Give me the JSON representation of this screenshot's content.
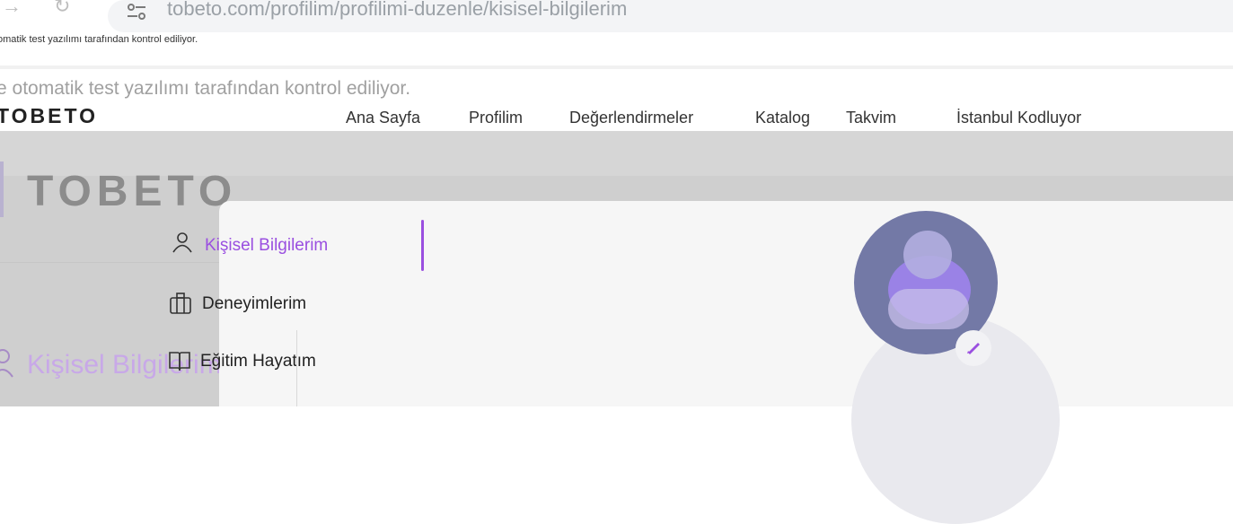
{
  "browser": {
    "url": "tobeto.com/profilim/profilimi-duzenle/kisisel-bilgilerim",
    "automation_notice": "omatik test yazılımı tarafından kontrol ediliyor."
  },
  "page": {
    "automation_notice": "e otomatik test yazılımı tarafından kontrol ediliyor.",
    "brand_small": "TOBETO",
    "brand_big": "TOBETO",
    "nav": [
      "Ana Sayfa",
      "Profilim",
      "Değerlendirmeler",
      "Katalog",
      "Takvim",
      "İstanbul Kodluyor"
    ],
    "ghost_heading": "Kişisel Bilgilerim"
  },
  "sidebar": {
    "items": [
      {
        "label": "Kişisel Bilgilerim",
        "icon": "user-icon",
        "active": true
      },
      {
        "label": "Deneyimlerim",
        "icon": "briefcase-icon",
        "active": false
      },
      {
        "label": "Eğitim Hayatım",
        "icon": "book-icon",
        "active": false
      }
    ]
  },
  "colors": {
    "accent": "#9a4fe0",
    "avatar_bg": "#7379a6",
    "overlay_gray": "#cfcfcf"
  }
}
